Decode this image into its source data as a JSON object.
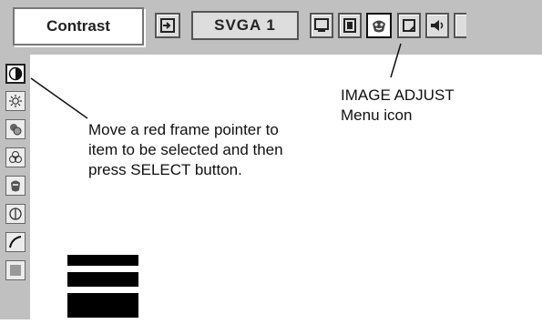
{
  "menu": {
    "current_item_label": "Contrast",
    "input_mode": "SVGA 1"
  },
  "toolbar_icons": [
    "input-icon",
    "pc-adjust-icon",
    "screen-icon",
    "image-adjust-icon",
    "setting-icon",
    "sound-icon",
    "menu-icon"
  ],
  "side_icons": [
    "contrast-icon",
    "brightness-icon",
    "color-icon",
    "tint-icon",
    "white-balance-icon",
    "sharpness-icon",
    "gamma-icon",
    "image-level-icon"
  ],
  "annotations": {
    "instruction_lines": [
      "Move a red frame pointer to",
      "item to be selected and then",
      "press SELECT button."
    ],
    "menu_icon_lines": [
      "IMAGE ADJUST",
      "Menu icon"
    ]
  },
  "level_indicator": {
    "bars_shown": 3
  },
  "colors": {
    "panel": "#c0c0c0",
    "text": "#111111",
    "bars": "#000000"
  }
}
